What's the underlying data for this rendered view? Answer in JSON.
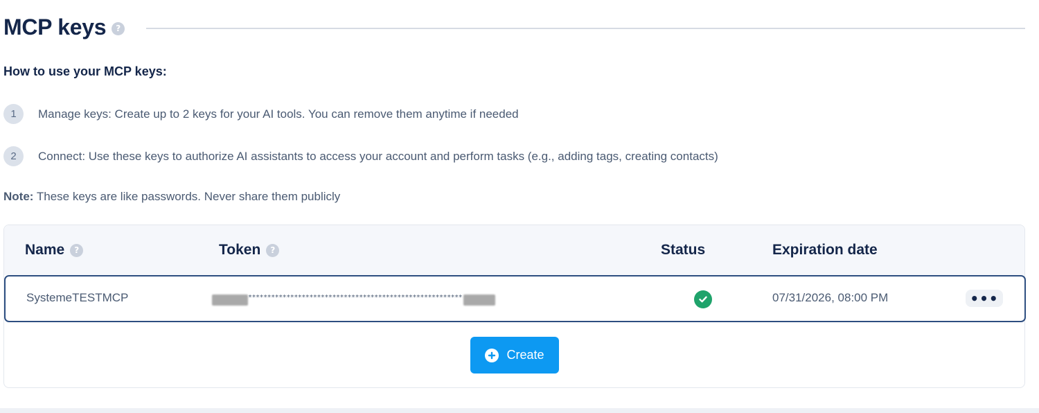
{
  "header": {
    "title": "MCP keys",
    "help_icon": "question-circle-icon"
  },
  "intro": {
    "subtitle": "How to use your MCP keys:",
    "steps": [
      {
        "num": "1",
        "text": "Manage keys: Create up to 2 keys for your AI tools. You can remove them anytime if needed"
      },
      {
        "num": "2",
        "text": "Connect: Use these keys to authorize AI assistants to access your account and perform tasks (e.g., adding tags, creating contacts)"
      }
    ],
    "note_label": "Note:",
    "note_text": " These keys are like passwords. Never share them publicly"
  },
  "table": {
    "columns": {
      "name": "Name",
      "token": "Token",
      "status": "Status",
      "expiration": "Expiration date"
    },
    "rows": [
      {
        "name": "SystemeTESTMCP",
        "token_masked": "********************************************************",
        "status_icon": "check-circle-icon",
        "expiration": "07/31/2026, 08:00 PM",
        "actions_label": "•••"
      }
    ]
  },
  "create_button": {
    "label": "Create",
    "icon": "plus-circle-icon"
  },
  "colors": {
    "title": "#14264a",
    "accent": "#0d99f2",
    "status_ok": "#1fa36b",
    "row_border": "#2d4e80"
  }
}
